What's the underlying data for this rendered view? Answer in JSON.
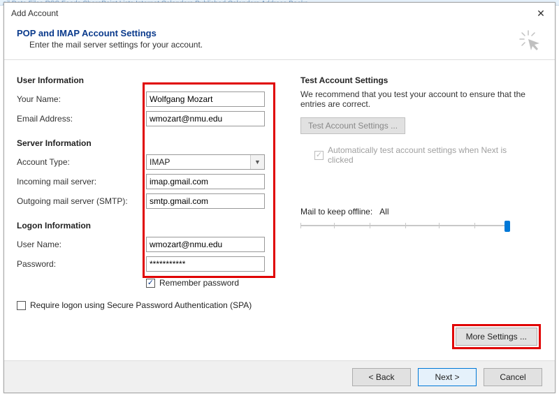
{
  "background_ribbon": "ail     Data Files    RSS Feeds    SharePoint Lists    Internet Calendars    Published Calendars    Address Books",
  "dialog": {
    "title": "Add Account",
    "header_title": "POP and IMAP Account Settings",
    "header_sub": "Enter the mail server settings for your account."
  },
  "left": {
    "user_info_head": "User Information",
    "your_name_label": "Your Name:",
    "your_name_value": "Wolfgang Mozart",
    "email_label": "Email Address:",
    "email_value": "wmozart@nmu.edu",
    "server_info_head": "Server Information",
    "account_type_label": "Account Type:",
    "account_type_value": "IMAP",
    "incoming_label": "Incoming mail server:",
    "incoming_value": "imap.gmail.com",
    "outgoing_label": "Outgoing mail server (SMTP):",
    "outgoing_value": "smtp.gmail.com",
    "logon_info_head": "Logon Information",
    "username_label": "User Name:",
    "username_value": "wmozart@nmu.edu",
    "password_label": "Password:",
    "password_value": "***********",
    "remember_password_label": "Remember password",
    "spa_label": "Require logon using Secure Password Authentication (SPA)"
  },
  "right": {
    "test_head": "Test Account Settings",
    "test_desc": "We recommend that you test your account to ensure that the entries are correct.",
    "test_button": "Test Account Settings ...",
    "auto_test_label": "Automatically test account settings when Next is clicked",
    "mail_offline_label": "Mail to keep offline:",
    "mail_offline_value": "All",
    "more_settings": "More Settings ..."
  },
  "footer": {
    "back": "< Back",
    "next": "Next >",
    "cancel": "Cancel"
  }
}
